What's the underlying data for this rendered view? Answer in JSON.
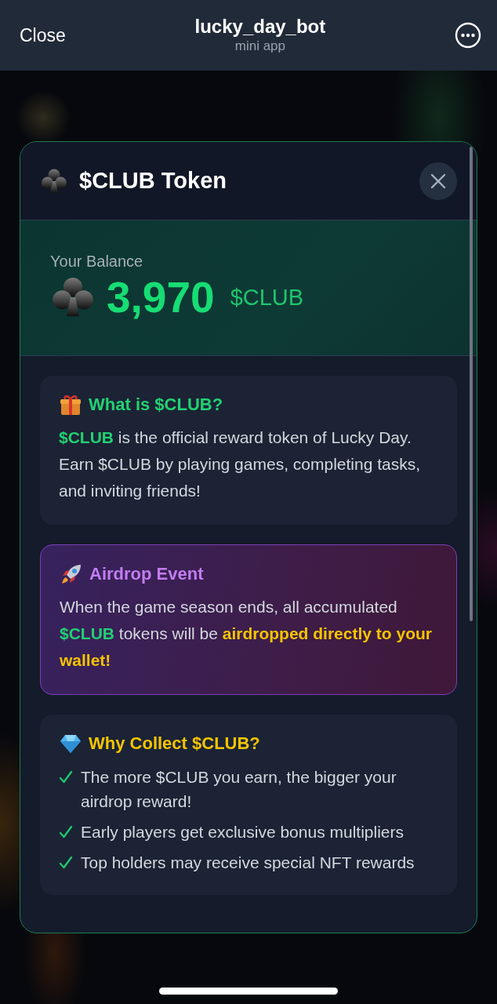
{
  "header": {
    "close": "Close",
    "title": "lucky_day_bot",
    "subtitle": "mini app"
  },
  "modal": {
    "title": "$CLUB Token",
    "balance": {
      "label": "Your Balance",
      "amount": "3,970",
      "unit": "$CLUB"
    },
    "cards": [
      {
        "kind": "info",
        "title": "What is $CLUB?",
        "parts": [
          {
            "text": "**$CLUB**",
            "color": "#22d172"
          },
          {
            "text": " is the official reward token of Lucky Day. Earn $CLUB by playing games, completing tasks, and inviting friends!",
            "color": "#d4d8de"
          }
        ]
      },
      {
        "kind": "event",
        "title": "Airdrop Event",
        "parts": [
          {
            "text": "When the game season ends, all accumulated ",
            "color": "#d4d8de"
          },
          {
            "text": "**$CLUB**",
            "color": "#22d172"
          },
          {
            "text": " tokens will be ",
            "color": "#d4d8de"
          },
          {
            "text": "**airdropped directly to your wallet!**",
            "color": "#f5c400"
          }
        ]
      },
      {
        "kind": "list",
        "title": "Why Collect $CLUB?",
        "items": [
          "The more $CLUB you earn, the bigger your airdrop reward!",
          "Early players get exclusive bonus multipliers",
          "Top holders may receive special NFT rewards"
        ]
      }
    ]
  }
}
